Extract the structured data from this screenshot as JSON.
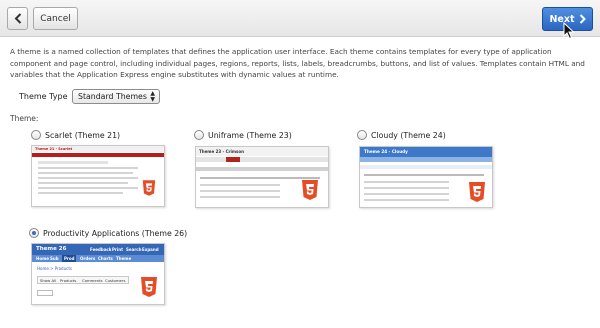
{
  "toolbar": {
    "cancel_label": "Cancel",
    "next_label": "Next"
  },
  "description": "A theme is a named collection of templates that defines the application user interface. Each theme contains templates for every type of application component and page control, including individual pages, regions, reports, lists, labels, breadcrumbs, buttons, and list of values. Templates contain HTML and variables that the Application Express engine substitutes with dynamic values at runtime.",
  "theme_type": {
    "label": "Theme Type",
    "selected": "Standard Themes"
  },
  "theme_label": "Theme:",
  "themes": [
    {
      "label": "Scarlet (Theme 21)",
      "selected": false,
      "thumb_title": "Theme 21 - Scarlet"
    },
    {
      "label": "Uniframe (Theme 23)",
      "selected": false,
      "thumb_title": "Theme 23 - Crimson"
    },
    {
      "label": "Cloudy (Theme 24)",
      "selected": false,
      "thumb_title": "Theme 24 - Cloudy"
    },
    {
      "label": "Productivity Applications (Theme 26)",
      "selected": true,
      "thumb_title": "Theme 26"
    }
  ],
  "thumb26": {
    "nav": [
      "Home",
      "Sub",
      "Prod",
      "Orders",
      "Charts",
      "Theme"
    ],
    "crumb": "Home > Products",
    "tabs": [
      "Show All",
      "Products",
      "Comments",
      "Customers"
    ],
    "header_links": [
      "Feedback",
      "Print",
      "Search",
      "Expand"
    ]
  },
  "colors": {
    "accent": "#2b66c2",
    "scarlet": "#b81d1d",
    "crimson": "#b3221b",
    "cloudy": "#3d78c9",
    "productivity": "#3567b7"
  }
}
